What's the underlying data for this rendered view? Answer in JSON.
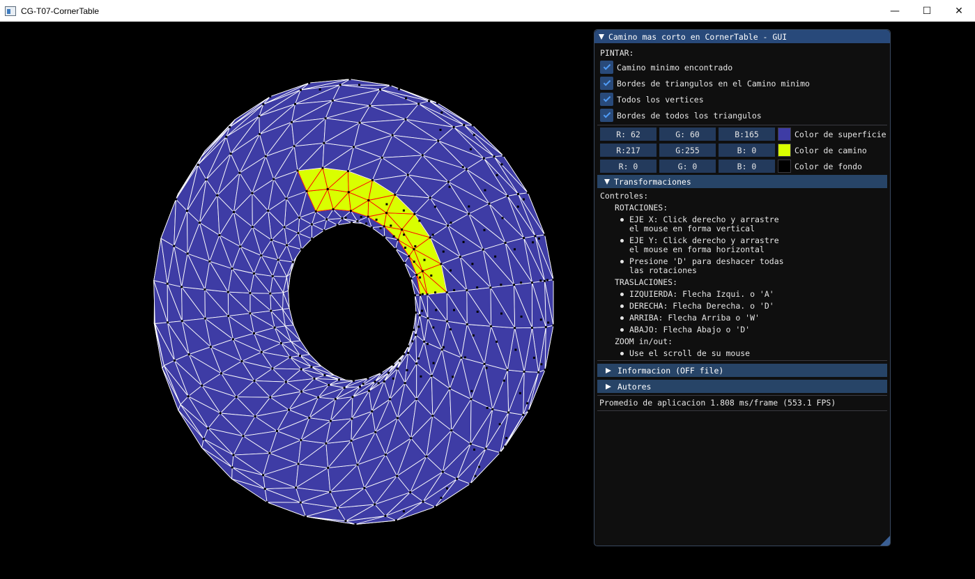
{
  "window": {
    "title": "CG-T07-CornerTable",
    "controls": {
      "minimize": "—",
      "maximize": "☐",
      "close": "✕"
    }
  },
  "gui": {
    "title": "Camino mas corto en CornerTable - GUI",
    "pintar_label": "PINTAR:",
    "checkboxes": [
      {
        "label": "Camino minimo encontrado",
        "checked": true
      },
      {
        "label": "Bordes de triangulos en el Camino minimo",
        "checked": true
      },
      {
        "label": "Todos los vertices",
        "checked": true
      },
      {
        "label": "Bordes de todos los triangulos",
        "checked": true
      }
    ],
    "colors": [
      {
        "r": "R: 62",
        "g": "G: 60",
        "b": "B:165",
        "label": "Color de superficie",
        "hex": "#3e3ca5"
      },
      {
        "r": "R:217",
        "g": "G:255",
        "b": "B:  0",
        "label": "Color de camino",
        "hex": "#d9ff00"
      },
      {
        "r": "R:  0",
        "g": "G:  0",
        "b": "B:  0",
        "label": "Color de fondo",
        "hex": "#000000"
      }
    ],
    "transformaciones": {
      "header": "Transformaciones",
      "controles_label": "Controles:",
      "rotaciones_label": "ROTACIONES:",
      "rotaciones": [
        "EJE X: Click derecho y arrastre\nel mouse en forma vertical",
        "EJE Y: Click derecho y arrastre\nel mouse en forma horizontal",
        "Presione 'D' para deshacer todas\nlas rotaciones"
      ],
      "traslaciones_label": "TRASLACIONES:",
      "traslaciones": [
        "IZQUIERDA: Flecha Izqui. o 'A'",
        "DERECHA: Flecha Derecha. o 'D'",
        "ARRIBA: Flecha Arriba o 'W'",
        "ABAJO: Flecha Abajo o 'D'"
      ],
      "zoom_label": "ZOOM in/out:",
      "zoom": [
        "Use el scroll de su mouse"
      ]
    },
    "informacion_header": "Informacion (OFF file)",
    "autores_header": "Autores",
    "fps_text": "Promedio de aplicacion 1.808 ms/frame (553.1 FPS)"
  },
  "scene": {
    "surface_color": "#3e3ca5",
    "path_color": "#d9ff00",
    "edge_color": "#ffffff",
    "path_edge_color": "#ff0000",
    "vertex_color": "#000000"
  }
}
